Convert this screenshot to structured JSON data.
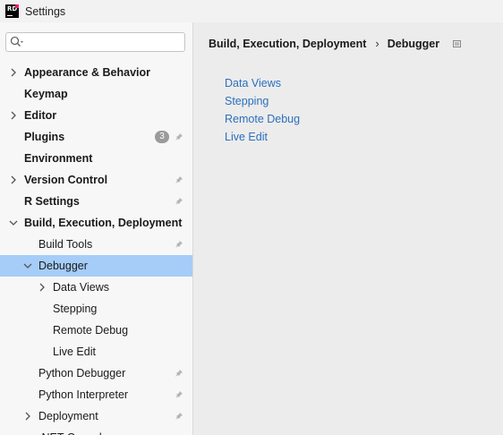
{
  "window": {
    "title": "Settings",
    "logo_text": "RD"
  },
  "search": {
    "value": "",
    "placeholder": ""
  },
  "tree": [
    {
      "label": "Appearance & Behavior",
      "bold": true,
      "level": 0,
      "chevron": "right",
      "pin": false
    },
    {
      "label": "Keymap",
      "bold": true,
      "level": 0,
      "chevron": "none",
      "pin": false
    },
    {
      "label": "Editor",
      "bold": true,
      "level": 0,
      "chevron": "right",
      "pin": false
    },
    {
      "label": "Plugins",
      "bold": true,
      "level": 0,
      "chevron": "none",
      "pin": true,
      "badge": "3"
    },
    {
      "label": "Environment",
      "bold": true,
      "level": 0,
      "chevron": "none",
      "pin": false
    },
    {
      "label": "Version Control",
      "bold": true,
      "level": 0,
      "chevron": "right",
      "pin": true
    },
    {
      "label": "R Settings",
      "bold": true,
      "level": 0,
      "chevron": "none",
      "pin": true
    },
    {
      "label": "Build, Execution, Deployment",
      "bold": true,
      "level": 0,
      "chevron": "down",
      "pin": false
    },
    {
      "label": "Build Tools",
      "bold": false,
      "level": 1,
      "chevron": "none",
      "pin": true
    },
    {
      "label": "Debugger",
      "bold": false,
      "level": 1,
      "chevron": "down",
      "pin": false,
      "selected": true
    },
    {
      "label": "Data Views",
      "bold": false,
      "level": 2,
      "chevron": "right",
      "pin": false
    },
    {
      "label": "Stepping",
      "bold": false,
      "level": 2,
      "chevron": "none",
      "pin": false
    },
    {
      "label": "Remote Debug",
      "bold": false,
      "level": 2,
      "chevron": "none",
      "pin": false
    },
    {
      "label": "Live Edit",
      "bold": false,
      "level": 2,
      "chevron": "none",
      "pin": false
    },
    {
      "label": "Python Debugger",
      "bold": false,
      "level": 1,
      "chevron": "none",
      "pin": true
    },
    {
      "label": "Python Interpreter",
      "bold": false,
      "level": 1,
      "chevron": "none",
      "pin": true
    },
    {
      "label": "Deployment",
      "bold": false,
      "level": 1,
      "chevron": "right",
      "pin": true
    },
    {
      "label": ".NET Console",
      "bold": false,
      "level": 1,
      "chevron": "none",
      "pin": false
    }
  ],
  "breadcrumb": {
    "parent": "Build, Execution, Deployment",
    "separator": "›",
    "current": "Debugger"
  },
  "links": [
    "Data Views",
    "Stepping",
    "Remote Debug",
    "Live Edit"
  ],
  "colors": {
    "selection": "#a5cdf8",
    "link": "#2c6fbe",
    "badge": "#9b9b9b"
  }
}
